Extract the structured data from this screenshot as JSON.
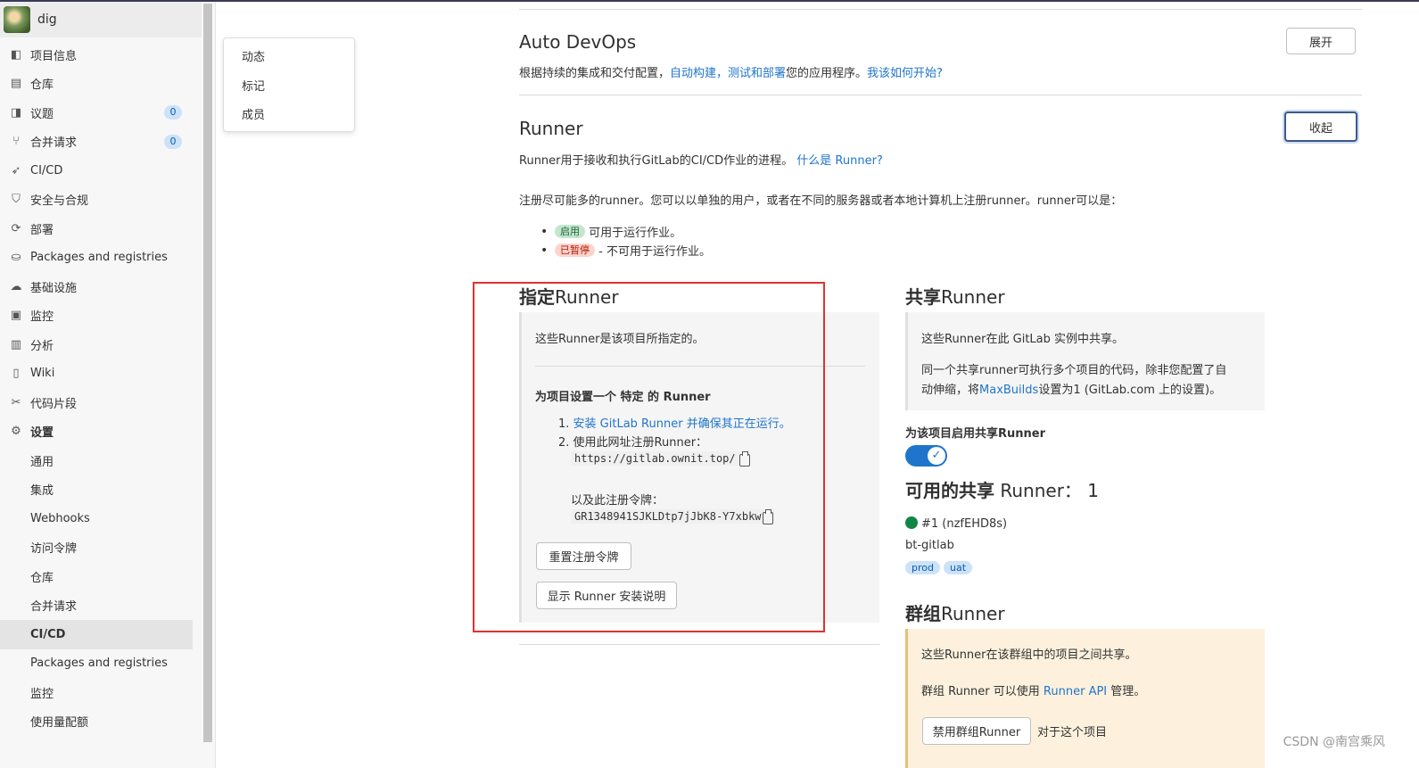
{
  "sidebar": {
    "project_name": "dig",
    "items": [
      {
        "label": "项目信息",
        "icon": "info-icon"
      },
      {
        "label": "仓库",
        "icon": "file-icon"
      },
      {
        "label": "议题",
        "icon": "issues-icon",
        "count": "0"
      },
      {
        "label": "合并请求",
        "icon": "merge-icon",
        "count": "0"
      },
      {
        "label": "CI/CD",
        "icon": "rocket-icon"
      },
      {
        "label": "安全与合规",
        "icon": "shield-icon"
      },
      {
        "label": "部署",
        "icon": "deploy-icon"
      },
      {
        "label": "Packages and registries",
        "icon": "package-icon"
      },
      {
        "label": "基础设施",
        "icon": "cloud-icon"
      },
      {
        "label": "监控",
        "icon": "monitor-icon"
      },
      {
        "label": "分析",
        "icon": "chart-icon"
      },
      {
        "label": "Wiki",
        "icon": "book-icon"
      },
      {
        "label": "代码片段",
        "icon": "scissors-icon"
      },
      {
        "label": "设置",
        "icon": "gear-icon"
      }
    ],
    "settings_sub": [
      "通用",
      "集成",
      "Webhooks",
      "访问令牌",
      "仓库",
      "合并请求",
      "CI/CD",
      "Packages and registries",
      "监控",
      "使用量配额"
    ]
  },
  "flyout": [
    "动态",
    "标记",
    "成员"
  ],
  "autodevops": {
    "title": "Auto DevOps",
    "desc_prefix": "根据持续的集成和交付配置，",
    "link1": "自动构建，测试和部署",
    "desc_mid": "您的应用程序。",
    "link2": "我该如何开始?",
    "button": "展开"
  },
  "runner": {
    "title": "Runner",
    "desc": "Runner用于接收和执行GitLab的CI/CD作业的进程。",
    "desc_link": "什么是 Runner?",
    "button": "收起",
    "register_text": "注册尽可能多的runner。您可以以单独的用户，或者在不同的服务器或者本地计算机上注册runner。runner可以是：",
    "badge_active": "启用",
    "active_text": "可用于运行作业。",
    "badge_paused": "已暂停",
    "paused_text": "- 不可用于运行作业。"
  },
  "specific": {
    "title_bold": "指定",
    "title_rest": "Runner",
    "intro": "这些Runner是该项目所指定的。",
    "setup_heading": "为项目设置一个 特定 的 Runner",
    "step1_num": "1.",
    "step1_link": "安装 GitLab Runner 并确保其正在运行。",
    "step2_num": "2.",
    "step2_text": "使用此网址注册Runner：",
    "url": "https://gitlab.ownit.top/",
    "token_label": "以及此注册令牌：",
    "token": "GR1348941SJKLDtp7jJbK8-Y7xbkw",
    "reset_button": "重置注册令牌",
    "show_button": "显示 Runner 安装说明"
  },
  "shared": {
    "title_bold": "共享",
    "title_rest": "Runner",
    "intro": "这些Runner在此 GitLab 实例中共享。",
    "desc_line1": "同一个共享runner可执行多个项目的代码，除非您配置了自",
    "desc_line2_a": "动伸缩，将",
    "desc_link": "MaxBuilds",
    "desc_line2_b": "设置为1 (GitLab.com 上的设置)。",
    "toggle_label": "为该项目启用共享Runner",
    "available_bold": "可用的共享",
    "available_rest": "Runner：",
    "available_count": "1",
    "runner_id": "#1 (nzfEHD8s)",
    "runner_name": "bt-gitlab",
    "tags": [
      "prod",
      "uat"
    ]
  },
  "group": {
    "title_bold": "群组",
    "title_rest": "Runner",
    "intro": "这些Runner在该群组中的项目之间共享。",
    "desc_a": "群组 Runner 可以使用 ",
    "desc_link": "Runner API",
    "desc_b": " 管理。",
    "button": "禁用群组Runner",
    "button_suffix": "对于这个项目"
  },
  "watermark": "CSDN @南宫乘风",
  "colors": {
    "accent": "#1f75cb",
    "highlight_box": "#e03131",
    "active_green": "#108548"
  }
}
